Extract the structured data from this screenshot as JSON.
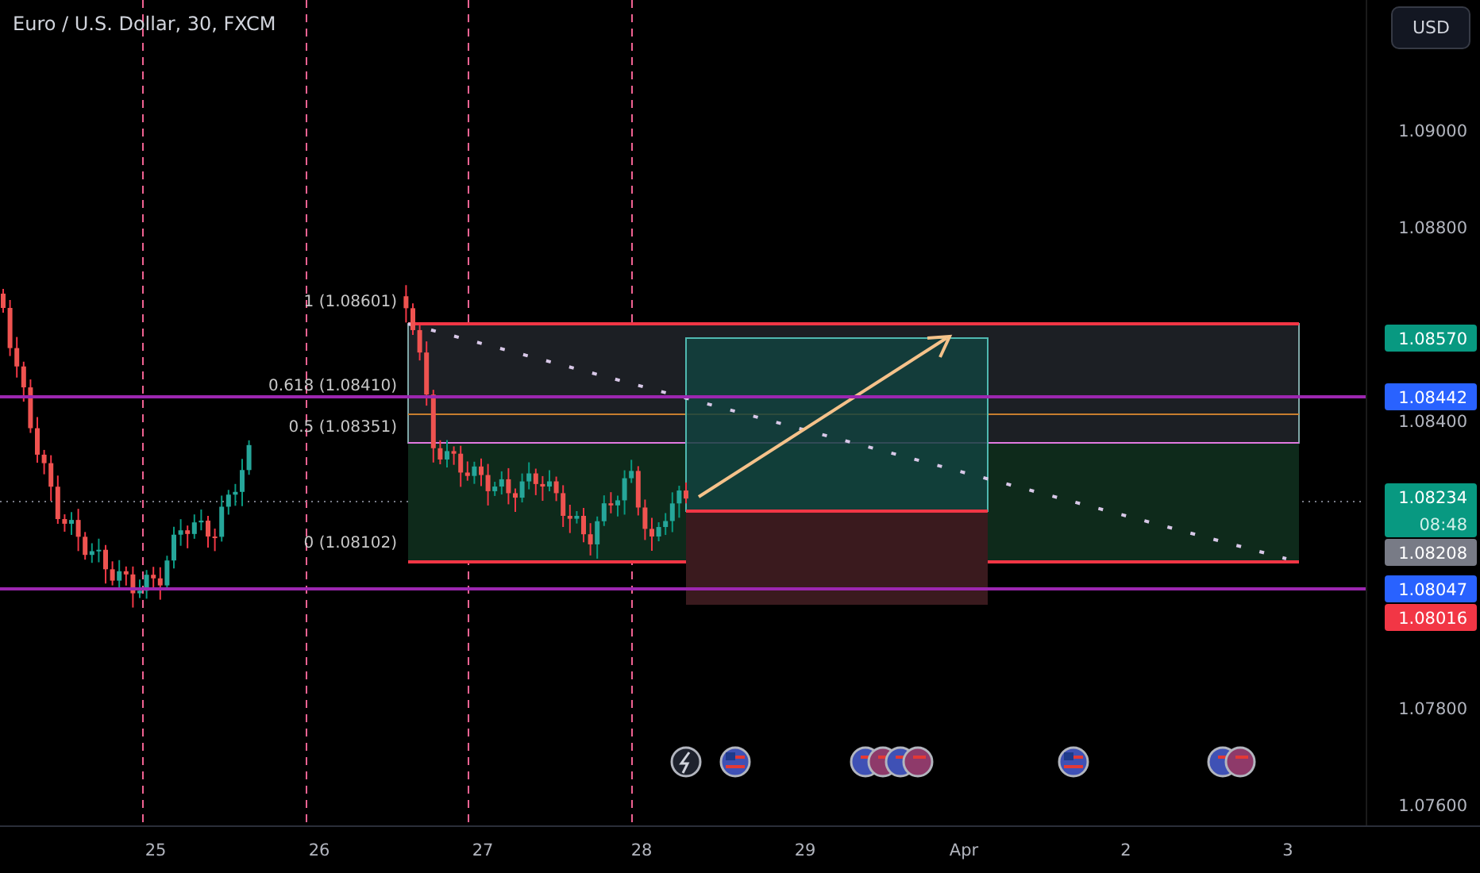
{
  "title": "Euro / U.S. Dollar, 30, FXCM",
  "currency_button": "USD",
  "price_axis": [
    "1.09000",
    "1.08800",
    "1.08400",
    "1.07800",
    "1.07600"
  ],
  "fib_labels": [
    "1 (1.08601)",
    "0.618 (1.08410)",
    "0.5 (1.08351)",
    "0 (1.08102)"
  ],
  "price_tags": [
    {
      "text": "1.08570",
      "color": "#089981"
    },
    {
      "text": "1.08442",
      "color": "#2962ff"
    },
    {
      "text": "1.08234",
      "countdown": "08:48",
      "color": "#089981"
    },
    {
      "text": "1.08208",
      "color": "#787b86"
    },
    {
      "text": "1.08047",
      "color": "#2962ff"
    },
    {
      "text": "1.08016",
      "color": "#f23645"
    }
  ],
  "events": [
    {
      "kind": "lightning"
    },
    {
      "kind": "flag"
    },
    {
      "kind": "flag_stack",
      "children": [
        {
          "kind": "flag"
        },
        {
          "kind": "flag"
        },
        {
          "kind": "flag"
        },
        {
          "kind": "flag"
        }
      ]
    },
    {
      "kind": "flag"
    },
    {
      "kind": "flag_stack",
      "children": [
        {
          "kind": "flag"
        },
        {
          "kind": "flag"
        }
      ]
    }
  ],
  "time_axis": [
    "25",
    "26",
    "27",
    "28",
    "29",
    "Apr",
    "2",
    "3"
  ]
}
